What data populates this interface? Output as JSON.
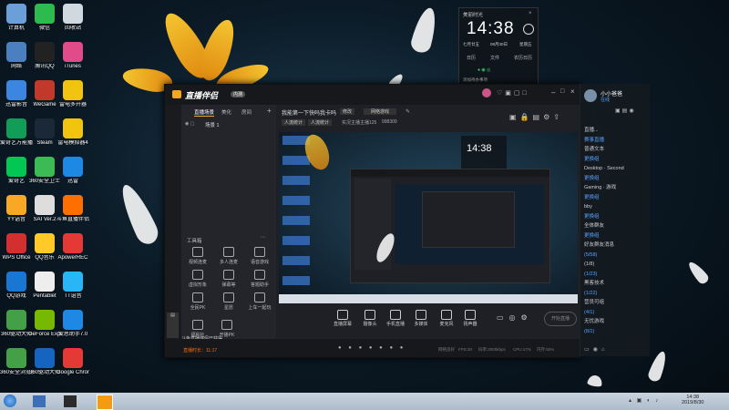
{
  "desktop_icons": [
    {
      "label": "计算机",
      "color": "#6a9fd8"
    },
    {
      "label": "微信",
      "color": "#2dbb4f"
    },
    {
      "label": "回收站",
      "color": "#d0d8e0"
    },
    {
      "label": "网络",
      "color": "#4a7fc0"
    },
    {
      "label": "腾讯QQ",
      "color": "#222"
    },
    {
      "label": "iTunes",
      "color": "#e24b8a"
    },
    {
      "label": "迅雷影音",
      "color": "#3a86e0"
    },
    {
      "label": "WeGame",
      "color": "#c0392b"
    },
    {
      "label": "雷电多开器",
      "color": "#f1c40f"
    },
    {
      "label": "爱奇艺万能播放",
      "color": "#0f9d58"
    },
    {
      "label": "Steam",
      "color": "#1b2838"
    },
    {
      "label": "雷电模拟器4",
      "color": "#f1c40f"
    },
    {
      "label": "爱奇艺",
      "color": "#00c853"
    },
    {
      "label": "360安全卫士",
      "color": "#3cba54"
    },
    {
      "label": "迅雷",
      "color": "#1e88e5"
    },
    {
      "label": "YY语音",
      "color": "#f9a825"
    },
    {
      "label": "SAI Ver.2",
      "color": "#ddd"
    },
    {
      "label": "斗鱼直播伴侣",
      "color": "#ff6f00"
    },
    {
      "label": "WPS Office",
      "color": "#d32f2f"
    },
    {
      "label": "QQ音乐",
      "color": "#ffca28"
    },
    {
      "label": "ApowerREC",
      "color": "#e53935"
    },
    {
      "label": "QQ游戏",
      "color": "#1976d2"
    },
    {
      "label": "Pentablet",
      "color": "#eee"
    },
    {
      "label": "TT语音",
      "color": "#29b6f6"
    },
    {
      "label": "360驱动大师",
      "color": "#43a047"
    },
    {
      "label": "GeForce Experience",
      "color": "#76b900"
    },
    {
      "label": "爱思助手7.0",
      "color": "#1e88e5"
    },
    {
      "label": "360安全浏览器",
      "color": "#43a047"
    },
    {
      "label": "360驱动大师",
      "color": "#1565c0"
    },
    {
      "label": "Google Chrome",
      "color": "#e53935"
    }
  ],
  "widget": {
    "header": "美丽时光",
    "time": "14:38",
    "date_left": "七月廿五",
    "date_mid": "08月30日",
    "date_right": "星期五",
    "opt1": "日历",
    "opt2": "文件",
    "opt3": "农历日历",
    "footer": "添加待办事项"
  },
  "app": {
    "title": "直播伴侣",
    "badge": "内测",
    "tabs": {
      "scene": "直播场景",
      "beauty": "美化",
      "room": "房间"
    },
    "scene_item": "场景 1",
    "stream_title": "我能第一下快吗我卡吗",
    "edit_label": "修改",
    "sub_tag": "网络游戏",
    "fps_tag": "人流统计",
    "viewers": "实况主播主播125",
    "rank": "998309",
    "tools_title": "工具箱",
    "tools": [
      "视频连麦",
      "多人连麦",
      "语音游戏",
      "虚拟形象",
      "弹幕等",
      "答题助手",
      "全民PK",
      "星愿",
      "上车一起玩"
    ],
    "side_bottom": [
      "福利社",
      "开播PK"
    ],
    "bottom_tools": [
      "直播屏幕",
      "摄像头",
      "手机直播",
      "多媒体",
      "麦克风",
      "扬声器"
    ],
    "start_label": "开始直播",
    "notice": "斗鱼直播伴侣已获得",
    "status": "直播时长：11:17",
    "stats": [
      "网络良好",
      "FPS:30",
      "码率:2000kbps",
      "CPU:17%",
      "内存:50%"
    ]
  },
  "chat": {
    "user": "小小爸爸",
    "status": "在线",
    "lines": [
      "直播...",
      "赛事直播",
      "普通文本",
      "更换组",
      "Desktop · Second",
      "更换组",
      "Gaming · 游戏",
      "更换组",
      "bby",
      "更换组",
      "全体群友",
      "更换组",
      "好友群友消息",
      "(5/58)",
      "(1/8)",
      "(1/23)",
      "黑客技术",
      "(1/22)",
      "营员可组",
      "(4/1)",
      "无忧游戏",
      "(8/1)"
    ]
  },
  "taskbar": {
    "time": "14:38",
    "date": "2019/8/30"
  }
}
